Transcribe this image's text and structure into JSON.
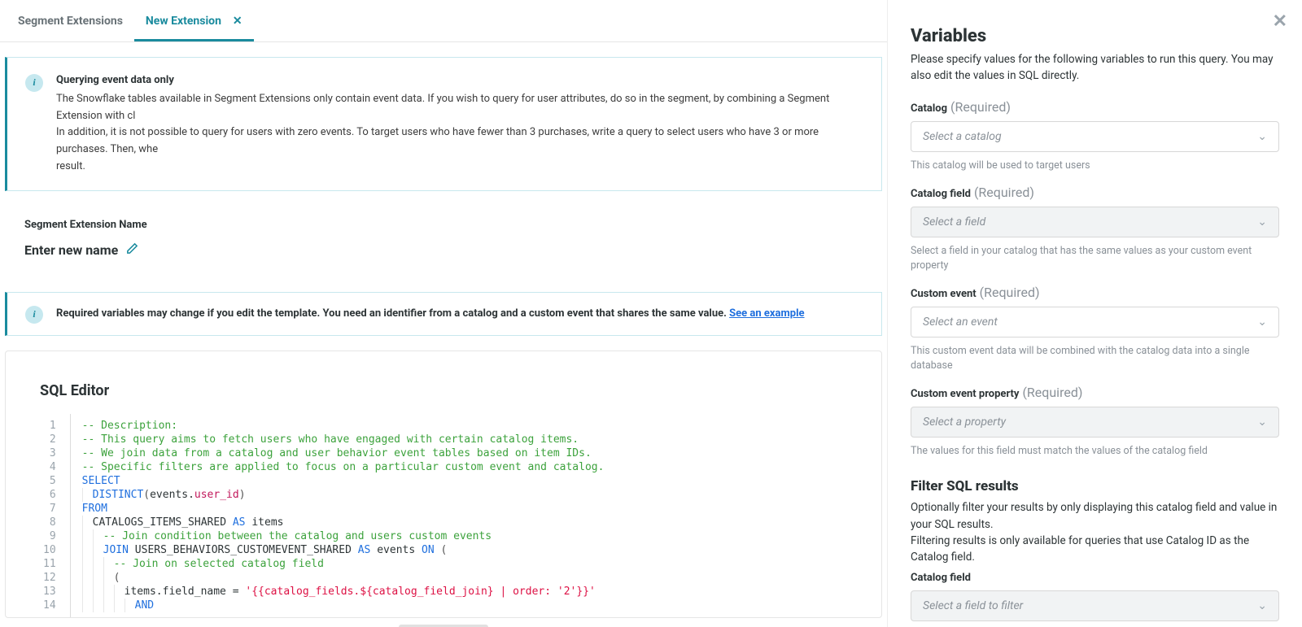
{
  "tabs": {
    "segment_extensions": "Segment Extensions",
    "new_extension": "New Extension"
  },
  "banner1": {
    "title": "Querying event data only",
    "line1": "The Snowflake tables available in Segment Extensions only contain event data. If you wish to query for user attributes, do so in the segment, by combining a Segment Extension with cl",
    "line2": "In addition, it is not possible to query for users with zero events. To target users who have fewer than 3 purchases, write a query to select users who have 3 or more purchases. Then, whe",
    "line3": "result."
  },
  "name_section": {
    "label": "Segment Extension Name",
    "placeholder": "Enter new name"
  },
  "banner2": {
    "text": "Required variables may change if you edit the template. You need an identifier from a catalog and a custom event that shares the same value. ",
    "link": "See an example"
  },
  "editor": {
    "title": "SQL Editor",
    "lines": {
      "l1": "-- Description:",
      "l2": "-- This query aims to fetch users who have engaged with certain catalog items.",
      "l3": "-- We join data from a catalog and user behavior event tables based on item IDs.",
      "l4": "-- Specific filters are applied to focus on a particular custom event and catalog.",
      "select": "SELECT",
      "distinct": "DISTINCT",
      "events_user": "events",
      "user_id": "user_id",
      "from": "FROM",
      "cat_items": "CATALOGS_ITEMS_SHARED",
      "as": "AS",
      "items": "items",
      "l9": "-- Join condition between the catalog and users custom events",
      "join": "JOIN",
      "users_behav": "USERS_BEHAVIORS_CUSTOMEVENT_SHARED",
      "events": "events",
      "on": "ON",
      "brace_open": "(",
      "l11": "-- Join on selected catalog field",
      "paren_open": "(",
      "items_field": "items.field_name =",
      "str": "'{{catalog_fields.${catalog_field_join} | order: '2'}}'",
      "and": "AND"
    },
    "line_numbers": [
      "1",
      "2",
      "3",
      "4",
      "5",
      "6",
      "7",
      "8",
      "9",
      "10",
      "11",
      "12",
      "13",
      "14"
    ]
  },
  "sidebar": {
    "title": "Variables",
    "desc": "Please specify values for the following variables to run this query. You may also edit the values in SQL directly.",
    "required": "(Required)",
    "catalog": {
      "label": "Catalog",
      "placeholder": "Select a catalog",
      "helper": "This catalog will be used to target users"
    },
    "catalog_field": {
      "label": "Catalog field",
      "placeholder": "Select a field",
      "helper": "Select a field in your catalog that has the same values as your custom event property"
    },
    "custom_event": {
      "label": "Custom event",
      "placeholder": "Select an event",
      "helper": "This custom event data will be combined with the catalog data into a single database"
    },
    "custom_event_prop": {
      "label": "Custom event property",
      "placeholder": "Select a property",
      "helper": "The values for this field must match the values of the catalog field"
    },
    "filter": {
      "title": "Filter SQL results",
      "line1": "Optionally filter your results by only displaying this catalog field and value in your SQL results.",
      "line2": "Filtering results is only available for queries that use Catalog ID as the Catalog field."
    },
    "filter_field": {
      "label": "Catalog field",
      "placeholder": "Select a field to filter"
    }
  }
}
